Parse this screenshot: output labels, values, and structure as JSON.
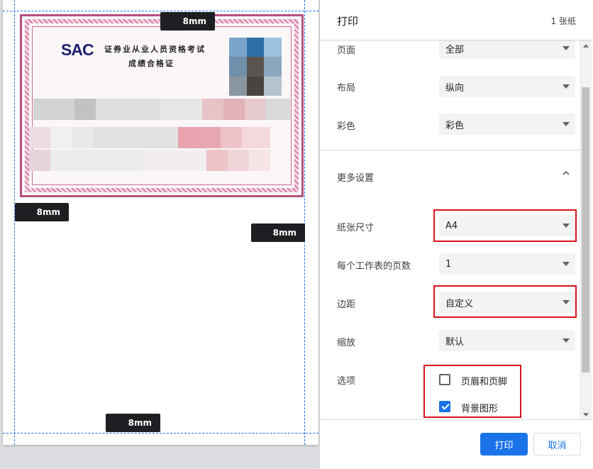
{
  "preview": {
    "margin_labels": {
      "top": "8mm",
      "left": "8mm",
      "right": "8mm",
      "bottom": "8mm"
    },
    "certificate": {
      "logo_text": "SAC",
      "title": "证券业从业人员资格考试",
      "subtitle": "成绩合格证",
      "colors": {
        "border": "#b4517d",
        "logo": "#1b1f6e"
      }
    }
  },
  "header": {
    "title": "打印",
    "sheet_count": "1 张纸"
  },
  "settings": {
    "pages": {
      "label": "页面",
      "value": "全部"
    },
    "layout": {
      "label": "布局",
      "value": "纵向"
    },
    "color": {
      "label": "彩色",
      "value": "彩色"
    },
    "more_settings": {
      "label": "更多设置",
      "expanded": true
    },
    "paper_size": {
      "label": "纸张尺寸",
      "value": "A4"
    },
    "pages_per_sheet": {
      "label": "每个工作表的页数",
      "value": "1"
    },
    "margins": {
      "label": "边距",
      "value": "自定义"
    },
    "scale": {
      "label": "缩放",
      "value": "默认"
    },
    "options": {
      "label": "选项",
      "headers_footers": {
        "label": "页眉和页脚",
        "checked": false
      },
      "background_graphics": {
        "label": "背景图形",
        "checked": true
      }
    }
  },
  "footer": {
    "print_label": "打印",
    "cancel_label": "取消"
  },
  "colors": {
    "accent": "#1a73e8",
    "highlight": "#d7141c"
  }
}
